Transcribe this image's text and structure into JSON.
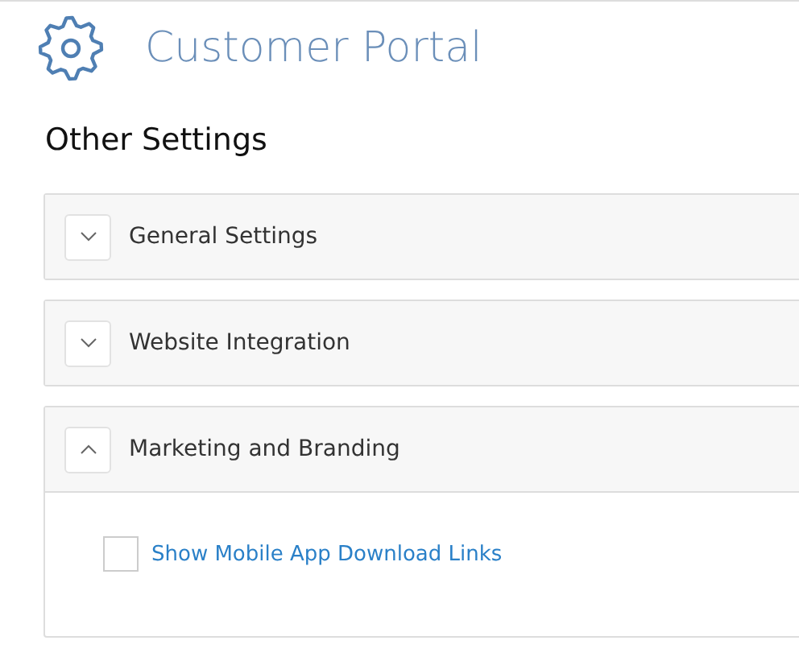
{
  "header": {
    "title": "Customer Portal"
  },
  "heading": "Other Settings",
  "sections": [
    {
      "title": "General Settings",
      "expanded": false
    },
    {
      "title": "Website Integration",
      "expanded": false
    },
    {
      "title": "Marketing and Branding",
      "expanded": true,
      "options": [
        {
          "kind": "checkbox",
          "label": "Show Mobile App Download Links",
          "checked": false
        }
      ]
    }
  ]
}
